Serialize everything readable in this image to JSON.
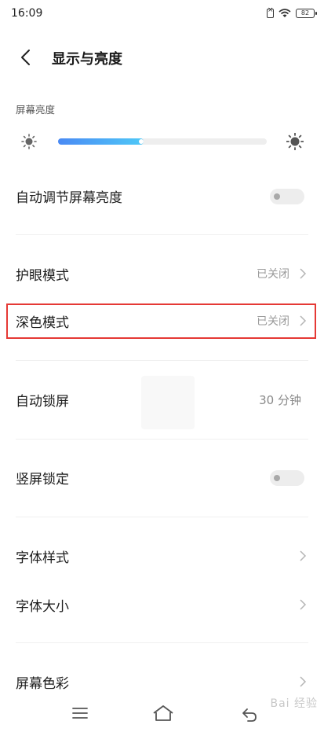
{
  "status_bar": {
    "time": "16:09",
    "battery_level": "82"
  },
  "header": {
    "title": "显示与亮度"
  },
  "brightness": {
    "section_label": "屏幕亮度",
    "level": 0.41
  },
  "settings": {
    "auto_brightness": {
      "label": "自动调节屏幕亮度",
      "enabled": false
    },
    "eye_care": {
      "label": "护眼模式",
      "value": "已关闭"
    },
    "dark_mode": {
      "label": "深色模式",
      "value": "已关闭"
    },
    "auto_lock": {
      "label": "自动锁屏",
      "value": "30 分钟"
    },
    "portrait_lock": {
      "label": "竖屏锁定",
      "enabled": false
    },
    "font_style": {
      "label": "字体样式"
    },
    "font_size": {
      "label": "字体大小"
    },
    "screen_color": {
      "label": "屏幕色彩"
    }
  },
  "watermark": {
    "text": "Bai 经验"
  },
  "colors": {
    "slider_start": "#4a8af4",
    "slider_end": "#4fc8f7",
    "highlight": "#e53935"
  }
}
